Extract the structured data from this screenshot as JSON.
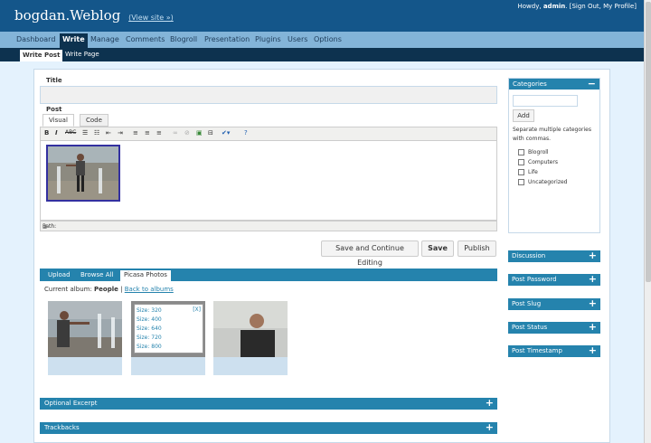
{
  "header": {
    "blog_title": "bogdan.Weblog",
    "view_site": "(View site »)",
    "howdy": "Howdy,",
    "user": "admin",
    "punct": ".",
    "sign_out": "[Sign Out,",
    "my_profile": "My Profile]"
  },
  "menu": [
    "Dashboard",
    "Write",
    "Manage",
    "Comments",
    "Blogroll",
    "Presentation",
    "Plugins",
    "Users",
    "Options"
  ],
  "submenu": [
    "Write Post",
    "Write Page"
  ],
  "post": {
    "title_label": "Title",
    "post_label": "Post",
    "tab_visual": "Visual",
    "tab_code": "Code",
    "path_label": "Path:",
    "toolbar_icons": [
      "bold-icon",
      "italic-icon",
      "strikethrough-icon",
      "bullet-list-icon",
      "numbered-list-icon",
      "outdent-icon",
      "indent-icon",
      "align-left-icon",
      "align-center-icon",
      "align-right-icon",
      "link-icon",
      "unlink-icon",
      "image-icon",
      "more-icon",
      "spellcheck-icon",
      "help-icon"
    ]
  },
  "buttons": {
    "save_continue": "Save and Continue Editing",
    "save": "Save",
    "publish": "Publish"
  },
  "media": {
    "tabs": [
      "Upload",
      "Browse All",
      "Picasa Photos"
    ],
    "current_album_label": "Current album:",
    "album_name": "People",
    "separator": "|",
    "back_link": "Back to albums",
    "sizes": [
      "Size: 320",
      "Size: 400",
      "Size: 640",
      "Size: 720",
      "Size: 800"
    ],
    "close": "[X]"
  },
  "bars": {
    "excerpt": "Optional Excerpt",
    "trackbacks": "Trackbacks"
  },
  "sidebar": {
    "categories_title": "Categories",
    "add_button": "Add",
    "hint": "Separate multiple categories with commas.",
    "categories": [
      "Blogroll",
      "Computers",
      "Life",
      "Uncategorized"
    ],
    "boxes": [
      "Discussion",
      "Post Password",
      "Post Slug",
      "Post Status",
      "Post Timestamp"
    ]
  },
  "colors": {
    "header": "#14568a",
    "menu": "#83b4d8",
    "accent": "#2583ad",
    "background": "#e4f2fd"
  }
}
